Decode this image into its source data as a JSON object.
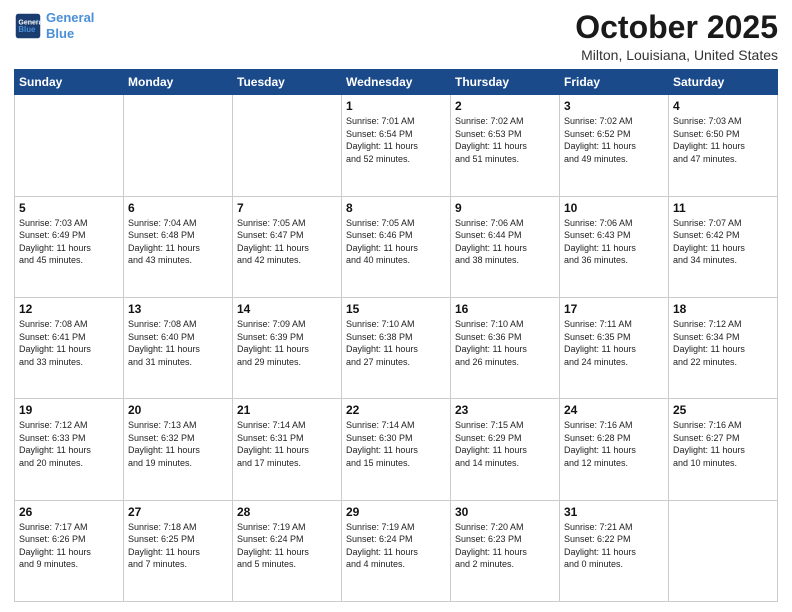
{
  "header": {
    "logo_line1": "General",
    "logo_line2": "Blue",
    "title": "October 2025",
    "subtitle": "Milton, Louisiana, United States"
  },
  "days_of_week": [
    "Sunday",
    "Monday",
    "Tuesday",
    "Wednesday",
    "Thursday",
    "Friday",
    "Saturday"
  ],
  "weeks": [
    [
      {
        "day": "",
        "info": ""
      },
      {
        "day": "",
        "info": ""
      },
      {
        "day": "",
        "info": ""
      },
      {
        "day": "1",
        "info": "Sunrise: 7:01 AM\nSunset: 6:54 PM\nDaylight: 11 hours\nand 52 minutes."
      },
      {
        "day": "2",
        "info": "Sunrise: 7:02 AM\nSunset: 6:53 PM\nDaylight: 11 hours\nand 51 minutes."
      },
      {
        "day": "3",
        "info": "Sunrise: 7:02 AM\nSunset: 6:52 PM\nDaylight: 11 hours\nand 49 minutes."
      },
      {
        "day": "4",
        "info": "Sunrise: 7:03 AM\nSunset: 6:50 PM\nDaylight: 11 hours\nand 47 minutes."
      }
    ],
    [
      {
        "day": "5",
        "info": "Sunrise: 7:03 AM\nSunset: 6:49 PM\nDaylight: 11 hours\nand 45 minutes."
      },
      {
        "day": "6",
        "info": "Sunrise: 7:04 AM\nSunset: 6:48 PM\nDaylight: 11 hours\nand 43 minutes."
      },
      {
        "day": "7",
        "info": "Sunrise: 7:05 AM\nSunset: 6:47 PM\nDaylight: 11 hours\nand 42 minutes."
      },
      {
        "day": "8",
        "info": "Sunrise: 7:05 AM\nSunset: 6:46 PM\nDaylight: 11 hours\nand 40 minutes."
      },
      {
        "day": "9",
        "info": "Sunrise: 7:06 AM\nSunset: 6:44 PM\nDaylight: 11 hours\nand 38 minutes."
      },
      {
        "day": "10",
        "info": "Sunrise: 7:06 AM\nSunset: 6:43 PM\nDaylight: 11 hours\nand 36 minutes."
      },
      {
        "day": "11",
        "info": "Sunrise: 7:07 AM\nSunset: 6:42 PM\nDaylight: 11 hours\nand 34 minutes."
      }
    ],
    [
      {
        "day": "12",
        "info": "Sunrise: 7:08 AM\nSunset: 6:41 PM\nDaylight: 11 hours\nand 33 minutes."
      },
      {
        "day": "13",
        "info": "Sunrise: 7:08 AM\nSunset: 6:40 PM\nDaylight: 11 hours\nand 31 minutes."
      },
      {
        "day": "14",
        "info": "Sunrise: 7:09 AM\nSunset: 6:39 PM\nDaylight: 11 hours\nand 29 minutes."
      },
      {
        "day": "15",
        "info": "Sunrise: 7:10 AM\nSunset: 6:38 PM\nDaylight: 11 hours\nand 27 minutes."
      },
      {
        "day": "16",
        "info": "Sunrise: 7:10 AM\nSunset: 6:36 PM\nDaylight: 11 hours\nand 26 minutes."
      },
      {
        "day": "17",
        "info": "Sunrise: 7:11 AM\nSunset: 6:35 PM\nDaylight: 11 hours\nand 24 minutes."
      },
      {
        "day": "18",
        "info": "Sunrise: 7:12 AM\nSunset: 6:34 PM\nDaylight: 11 hours\nand 22 minutes."
      }
    ],
    [
      {
        "day": "19",
        "info": "Sunrise: 7:12 AM\nSunset: 6:33 PM\nDaylight: 11 hours\nand 20 minutes."
      },
      {
        "day": "20",
        "info": "Sunrise: 7:13 AM\nSunset: 6:32 PM\nDaylight: 11 hours\nand 19 minutes."
      },
      {
        "day": "21",
        "info": "Sunrise: 7:14 AM\nSunset: 6:31 PM\nDaylight: 11 hours\nand 17 minutes."
      },
      {
        "day": "22",
        "info": "Sunrise: 7:14 AM\nSunset: 6:30 PM\nDaylight: 11 hours\nand 15 minutes."
      },
      {
        "day": "23",
        "info": "Sunrise: 7:15 AM\nSunset: 6:29 PM\nDaylight: 11 hours\nand 14 minutes."
      },
      {
        "day": "24",
        "info": "Sunrise: 7:16 AM\nSunset: 6:28 PM\nDaylight: 11 hours\nand 12 minutes."
      },
      {
        "day": "25",
        "info": "Sunrise: 7:16 AM\nSunset: 6:27 PM\nDaylight: 11 hours\nand 10 minutes."
      }
    ],
    [
      {
        "day": "26",
        "info": "Sunrise: 7:17 AM\nSunset: 6:26 PM\nDaylight: 11 hours\nand 9 minutes."
      },
      {
        "day": "27",
        "info": "Sunrise: 7:18 AM\nSunset: 6:25 PM\nDaylight: 11 hours\nand 7 minutes."
      },
      {
        "day": "28",
        "info": "Sunrise: 7:19 AM\nSunset: 6:24 PM\nDaylight: 11 hours\nand 5 minutes."
      },
      {
        "day": "29",
        "info": "Sunrise: 7:19 AM\nSunset: 6:24 PM\nDaylight: 11 hours\nand 4 minutes."
      },
      {
        "day": "30",
        "info": "Sunrise: 7:20 AM\nSunset: 6:23 PM\nDaylight: 11 hours\nand 2 minutes."
      },
      {
        "day": "31",
        "info": "Sunrise: 7:21 AM\nSunset: 6:22 PM\nDaylight: 11 hours\nand 0 minutes."
      },
      {
        "day": "",
        "info": ""
      }
    ]
  ]
}
